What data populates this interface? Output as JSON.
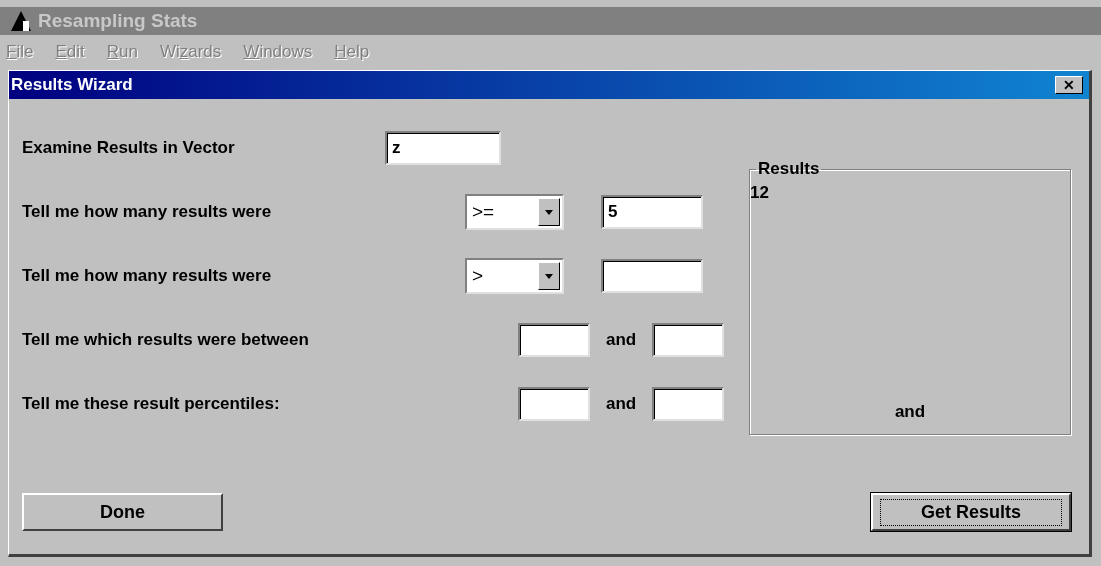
{
  "app": {
    "title": "Resampling Stats",
    "active": false
  },
  "menu": [
    {
      "key": "F",
      "post": "ile",
      "disabled": true
    },
    {
      "key": "E",
      "post": "dit",
      "disabled": true
    },
    {
      "key": "R",
      "post": "un",
      "disabled": true
    },
    {
      "pre": "Wi",
      "key": "z",
      "post": "ards",
      "disabled": true
    },
    {
      "key": "W",
      "post": "indows",
      "disabled": true
    },
    {
      "key": "H",
      "post": "elp",
      "disabled": true
    }
  ],
  "dialog": {
    "title": "Results Wizard",
    "close": "✕",
    "rows": [
      {
        "kind": "text",
        "label": "Examine Results in Vector",
        "value": "z"
      },
      {
        "kind": "compare",
        "label": "Tell me how many results were",
        "operator": ">=",
        "value": "5"
      },
      {
        "kind": "compare",
        "label": "Tell me how many results were",
        "operator": ">"
      },
      {
        "kind": "range",
        "label": "Tell me which results were between",
        "joiner": "and"
      },
      {
        "kind": "range",
        "label": "Tell me these result percentiles:",
        "joiner": "and"
      }
    ],
    "results": {
      "title": "Results",
      "lines": [
        "12"
      ],
      "footer": "and"
    },
    "buttons": [
      {
        "label": "Done",
        "default": false
      },
      {
        "label": "Get Results",
        "default": true
      }
    ]
  }
}
